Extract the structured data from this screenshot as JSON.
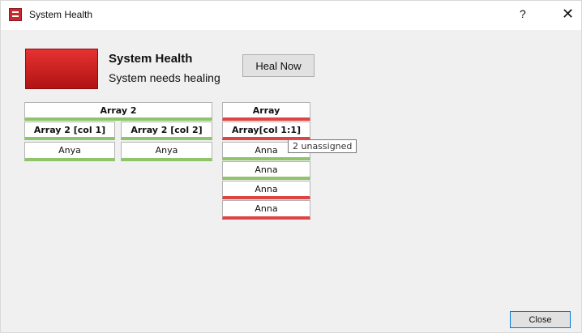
{
  "window": {
    "title": "System Health",
    "help_label": "?",
    "close_label": "✕",
    "icon": "system-health-app-icon"
  },
  "health": {
    "title": "System Health",
    "status": "System needs healing",
    "status_color": "#d12020",
    "heal_label": "Heal Now"
  },
  "arrays": {
    "array2": {
      "title": "Array 2",
      "status": "ok",
      "columns": [
        {
          "header": "Array 2 [col 1]",
          "status": "ok",
          "items": [
            {
              "label": "Anya",
              "status": "ok"
            }
          ]
        },
        {
          "header": "Array 2 [col 2]",
          "status": "ok",
          "items": [
            {
              "label": "Anya",
              "status": "ok"
            }
          ]
        }
      ]
    },
    "array": {
      "title": "Array",
      "status": "bad",
      "columns": [
        {
          "header": "Array[col 1:1]",
          "status": "bad",
          "items": [
            {
              "label": "Anna",
              "status": "ok"
            },
            {
              "label": "Anna",
              "status": "ok"
            },
            {
              "label": "Anna",
              "status": "bad"
            },
            {
              "label": "Anna",
              "status": "bad"
            }
          ]
        }
      ]
    }
  },
  "tooltip": "2 unassigned",
  "footer": {
    "close_label": "Close"
  },
  "colors": {
    "ok": "#8fc56a",
    "bad": "#dd4444",
    "dialog_bg": "#f0f0f0",
    "focus_border": "#0078d7"
  }
}
